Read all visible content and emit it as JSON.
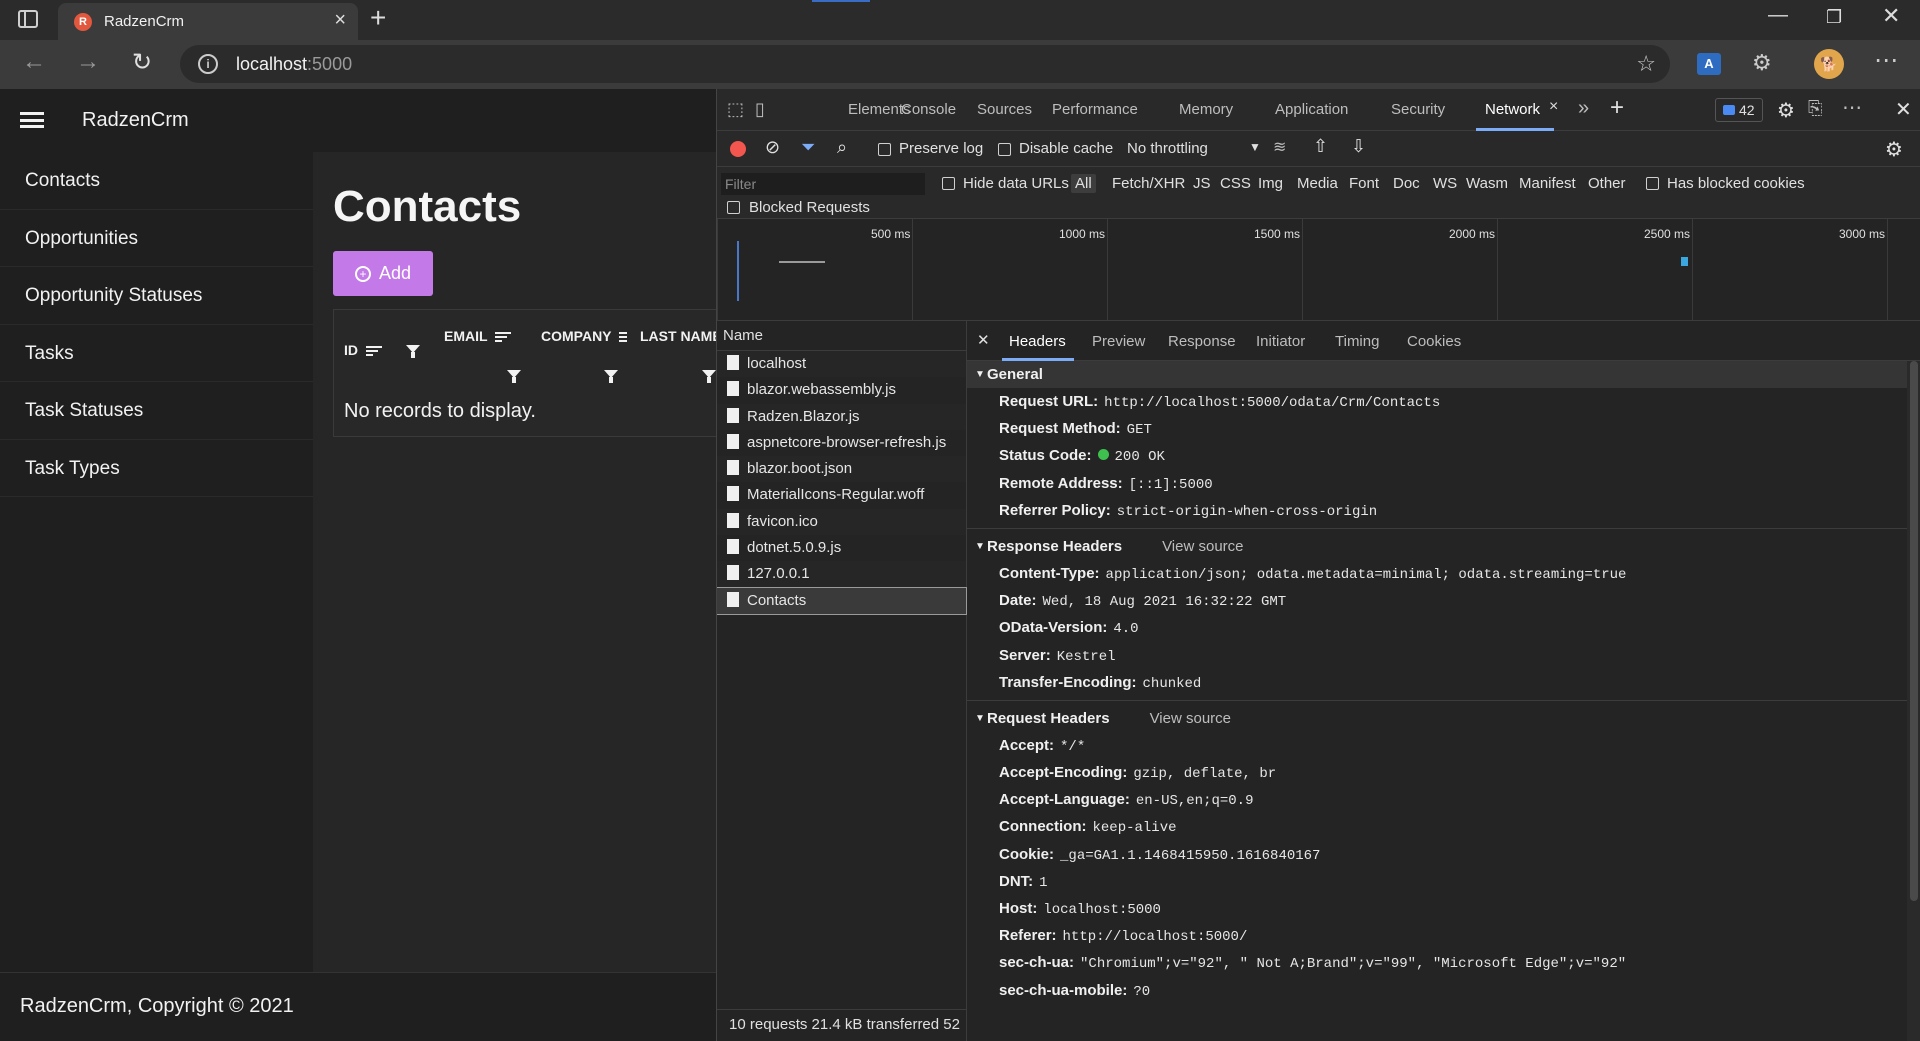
{
  "browser": {
    "tab_title": "RadzenCrm",
    "url_host": "localhost",
    "url_port": ":5000"
  },
  "app": {
    "brand": "RadzenCrm",
    "sidebar": {
      "items": [
        {
          "label": "Contacts"
        },
        {
          "label": "Opportunities"
        },
        {
          "label": "Opportunity Statuses"
        },
        {
          "label": "Tasks"
        },
        {
          "label": "Task Statuses"
        },
        {
          "label": "Task Types"
        }
      ]
    },
    "page_title": "Contacts",
    "add_label": "Add",
    "grid": {
      "columns": [
        "ID",
        "EMAIL",
        "COMPANY",
        "LAST NAME"
      ],
      "empty_text": "No records to display."
    },
    "footer": "RadzenCrm, Copyright © 2021"
  },
  "devtools": {
    "tabs": [
      "Elements",
      "Console",
      "Sources",
      "Performance",
      "Memory",
      "Application",
      "Security",
      "Network"
    ],
    "active_tab": "Network",
    "issues_count": "42",
    "toolbar": {
      "preserve_log": "Preserve log",
      "disable_cache": "Disable cache",
      "throttling": "No throttling"
    },
    "filter": {
      "placeholder": "Filter",
      "hide_data_urls": "Hide data URLs",
      "types": [
        "All",
        "Fetch/XHR",
        "JS",
        "CSS",
        "Img",
        "Media",
        "Font",
        "Doc",
        "WS",
        "Wasm",
        "Manifest",
        "Other"
      ],
      "has_blocked_cookies": "Has blocked cookies",
      "blocked_requests": "Blocked Requests"
    },
    "overview_labels": [
      "500 ms",
      "1000 ms",
      "1500 ms",
      "2000 ms",
      "2500 ms",
      "3000 ms"
    ],
    "name_column": "Name",
    "requests": [
      "localhost",
      "blazor.webassembly.js",
      "Radzen.Blazor.js",
      "aspnetcore-browser-refresh.js",
      "blazor.boot.json",
      "MaterialIcons-Regular.woff",
      "favicon.ico",
      "dotnet.5.0.9.js",
      "127.0.0.1",
      "Contacts"
    ],
    "selected_request": "Contacts",
    "summary": "10 requests  21.4 kB transferred  52",
    "detail_tabs": [
      "Headers",
      "Preview",
      "Response",
      "Initiator",
      "Timing",
      "Cookies"
    ],
    "general": {
      "title": "General",
      "rows": [
        {
          "k": "Request URL:",
          "v": "http://localhost:5000/odata/Crm/Contacts"
        },
        {
          "k": "Request Method:",
          "v": "GET"
        },
        {
          "k": "Status Code:",
          "v": "200 OK"
        },
        {
          "k": "Remote Address:",
          "v": "[::1]:5000"
        },
        {
          "k": "Referrer Policy:",
          "v": "strict-origin-when-cross-origin"
        }
      ]
    },
    "response_headers": {
      "title": "Response Headers",
      "view_source": "View source",
      "rows": [
        {
          "k": "Content-Type:",
          "v": "application/json; odata.metadata=minimal; odata.streaming=true"
        },
        {
          "k": "Date:",
          "v": "Wed, 18 Aug 2021 16:32:22 GMT"
        },
        {
          "k": "OData-Version:",
          "v": "4.0"
        },
        {
          "k": "Server:",
          "v": "Kestrel"
        },
        {
          "k": "Transfer-Encoding:",
          "v": "chunked"
        }
      ]
    },
    "request_headers": {
      "title": "Request Headers",
      "view_source": "View source",
      "rows": [
        {
          "k": "Accept:",
          "v": "*/*"
        },
        {
          "k": "Accept-Encoding:",
          "v": "gzip, deflate, br"
        },
        {
          "k": "Accept-Language:",
          "v": "en-US,en;q=0.9"
        },
        {
          "k": "Connection:",
          "v": "keep-alive"
        },
        {
          "k": "Cookie:",
          "v": "_ga=GA1.1.1468415950.1616840167"
        },
        {
          "k": "DNT:",
          "v": "1"
        },
        {
          "k": "Host:",
          "v": "localhost:5000"
        },
        {
          "k": "Referer:",
          "v": "http://localhost:5000/"
        },
        {
          "k": "sec-ch-ua:",
          "v": "\"Chromium\";v=\"92\", \" Not A;Brand\";v=\"99\", \"Microsoft Edge\";v=\"92\""
        },
        {
          "k": "sec-ch-ua-mobile:",
          "v": "?0"
        }
      ]
    }
  }
}
